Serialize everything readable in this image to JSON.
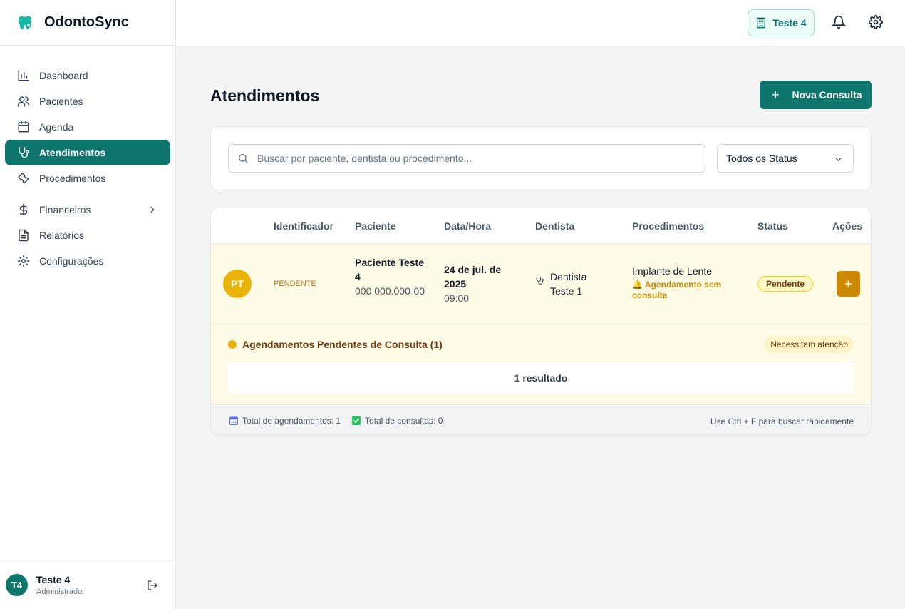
{
  "brand": {
    "name": "OdontoSync",
    "icon": "tooth-icon"
  },
  "sidebar": {
    "items": [
      {
        "label": "Dashboard",
        "icon": "bar-chart-icon"
      },
      {
        "label": "Pacientes",
        "icon": "users-icon"
      },
      {
        "label": "Agenda",
        "icon": "calendar-icon"
      },
      {
        "label": "Atendimentos",
        "icon": "stethoscope-icon",
        "active": true
      },
      {
        "label": "Procedimentos",
        "icon": "wrench-icon"
      },
      {
        "label": "Financeiros",
        "icon": "dollar-icon",
        "expandable": true
      },
      {
        "label": "Relatórios",
        "icon": "file-text-icon"
      },
      {
        "label": "Configurações",
        "icon": "settings-icon"
      }
    ]
  },
  "user": {
    "initials": "T4",
    "name": "Teste 4",
    "role": "Administrador"
  },
  "topbar": {
    "clinic": "Teste 4"
  },
  "page": {
    "title": "Atendimentos",
    "new_button": "Nova Consulta"
  },
  "filters": {
    "search_placeholder": "Buscar por paciente, dentista ou procedimento...",
    "status_selected": "Todos os Status"
  },
  "table": {
    "columns": [
      "Identificador",
      "Paciente",
      "Data/Hora",
      "Dentista",
      "Procedimentos",
      "Status",
      "Ações"
    ],
    "rows": [
      {
        "initials": "PT",
        "identifier": "PENDENTE",
        "patient_name": "Paciente Teste 4",
        "patient_cpf": "000.000.000-00",
        "date": "24 de jul. de 2025",
        "time": "09:00",
        "dentist": "Dentista Teste 1",
        "procedure": "Implante de Lente",
        "procedure_note": "🔔 Agendamento sem consulta",
        "status": "Pendente"
      }
    ]
  },
  "pending_section": {
    "title": "Agendamentos Pendentes de Consulta (1)",
    "badge": "Necessitam atenção",
    "result": "1 resultado"
  },
  "footer": {
    "total_appointments": "Total de agendamentos: 1",
    "total_consultations": "Total de consultas: 0",
    "hint": "Use Ctrl + F para buscar rapidamente"
  },
  "colors": {
    "primary": "#0f766e",
    "pending": "#eab308",
    "pending_bg": "#fefbe6"
  }
}
